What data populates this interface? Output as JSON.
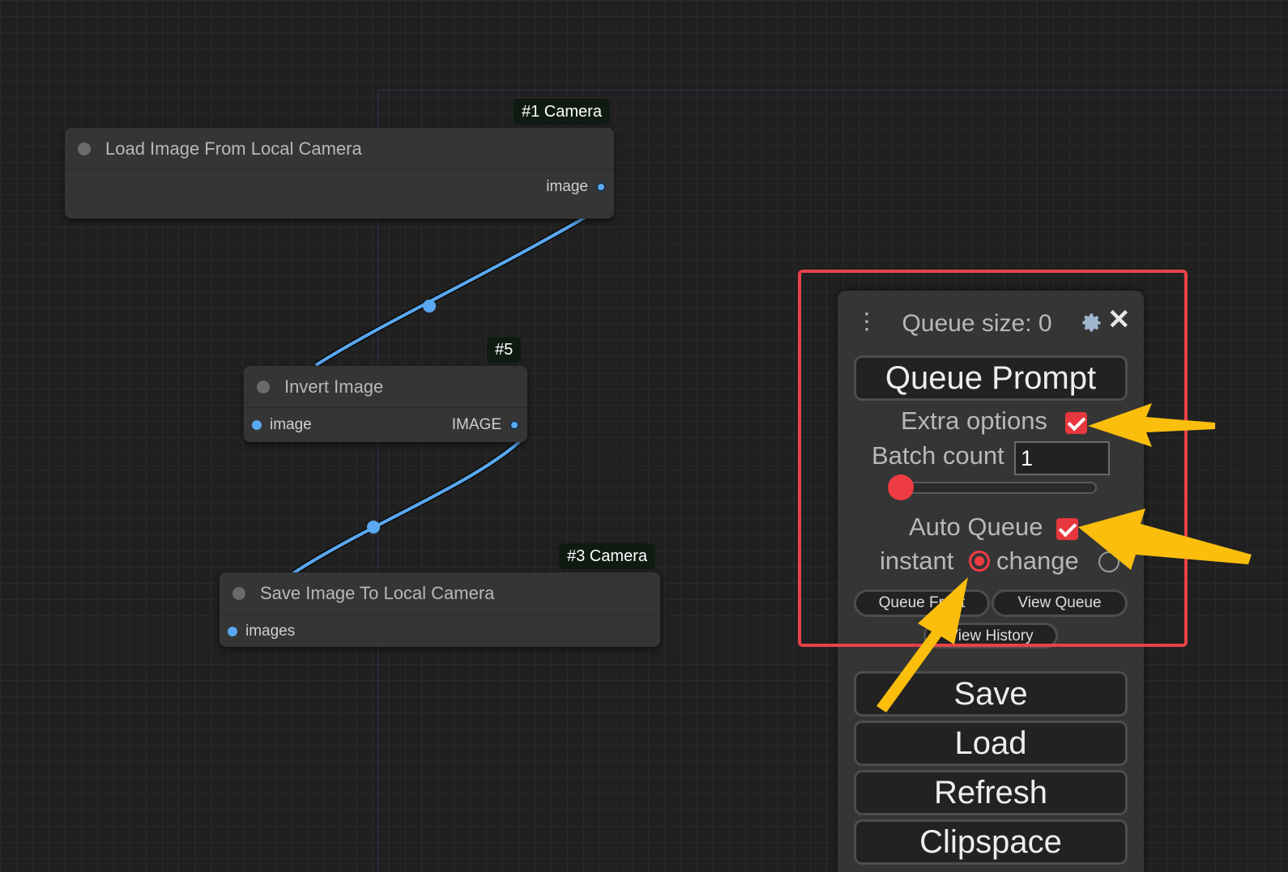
{
  "colors": {
    "canvas_bg": "#202020",
    "node_bg": "#353535",
    "link": "#5aa8f0",
    "accent": "#ef3b43",
    "annotation_arrow": "#fbbe0d",
    "highlight_box": "#e8424a"
  },
  "nodes": [
    {
      "badge": "#1 Camera",
      "title": "Load Image From Local Camera",
      "outputs": [
        "image"
      ]
    },
    {
      "badge": "#5",
      "title": "Invert Image",
      "inputs": [
        "image"
      ],
      "outputs": [
        "IMAGE"
      ]
    },
    {
      "badge": "#3 Camera",
      "title": "Save Image To Local Camera",
      "inputs": [
        "images"
      ]
    }
  ],
  "panel": {
    "drag_icon": "drag-handle-icon",
    "queue_size": "Queue size: 0",
    "settings_icon": "gear-icon",
    "close_icon": "close-icon",
    "close_glyph": "✕",
    "queue_prompt": "Queue Prompt",
    "extra_options": {
      "label": "Extra options",
      "checked": true
    },
    "batch_count": {
      "label": "Batch count",
      "value": "1"
    },
    "batch_slider": {
      "value": 1
    },
    "auto_queue": {
      "label": "Auto Queue",
      "checked": true
    },
    "auto_mode": {
      "instant": {
        "label": "instant",
        "selected": true
      },
      "change": {
        "label": "change",
        "selected": false
      }
    },
    "queue_front": "Queue Front",
    "view_queue": "View Queue",
    "view_history": "View History",
    "buttons": [
      "Save",
      "Load",
      "Refresh",
      "Clipspace"
    ]
  }
}
